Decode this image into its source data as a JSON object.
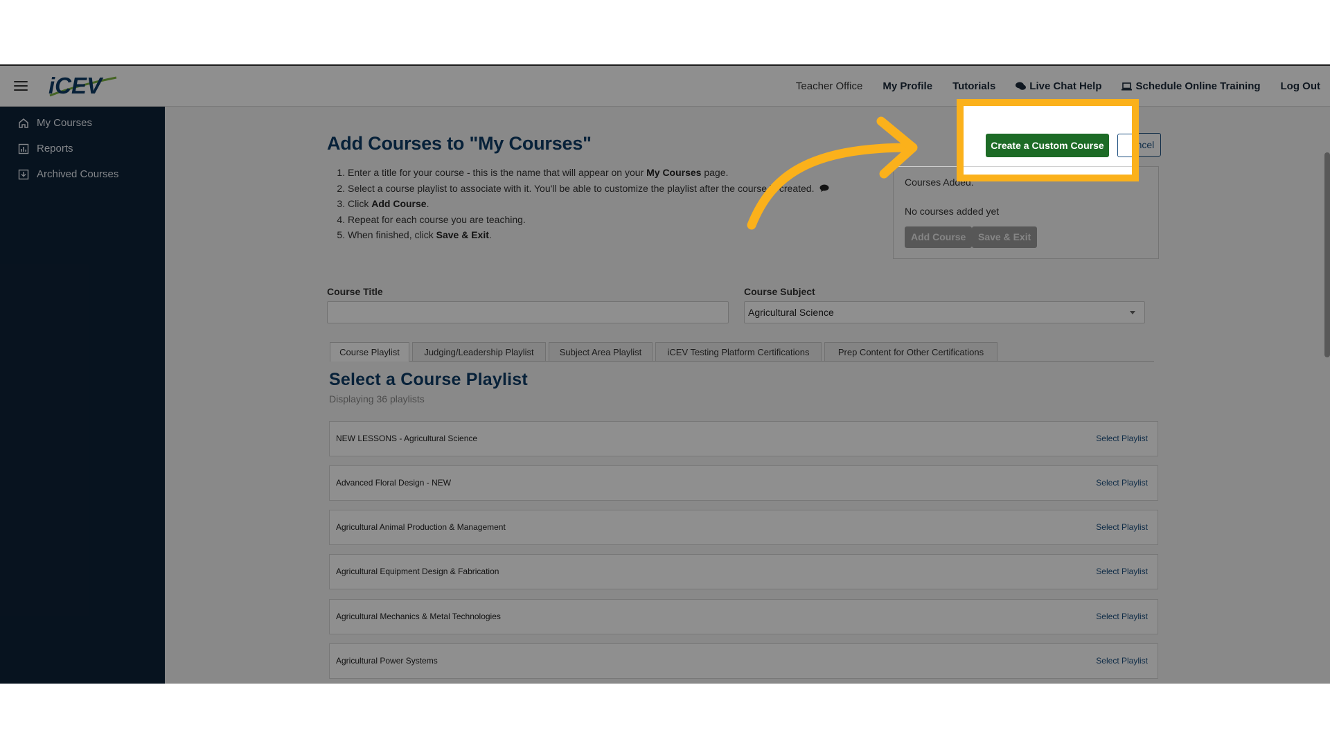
{
  "brand": {
    "logo_text": "iCEV"
  },
  "topnav": {
    "teacher_office": "Teacher Office",
    "my_profile": "My Profile",
    "tutorials": "Tutorials",
    "live_chat": "Live Chat Help",
    "schedule_training": "Schedule Online Training",
    "log_out": "Log Out"
  },
  "sidebar": {
    "items": [
      {
        "label": "My Courses",
        "icon": "home-icon"
      },
      {
        "label": "Reports",
        "icon": "chart-icon"
      },
      {
        "label": "Archived Courses",
        "icon": "archive-icon"
      }
    ]
  },
  "page": {
    "title": "Add Courses to \"My Courses\"",
    "steps": {
      "s1_pre": "Enter a title for your course - this is the name that will appear on your ",
      "s1_bold": "My Courses",
      "s1_post": " page.",
      "s2": "Select a course playlist to associate with it. You'll be able to customize the playlist after the course is created.",
      "s3_pre": "Click ",
      "s3_bold": "Add Course",
      "s3_post": ".",
      "s4": "Repeat for each course you are teaching.",
      "s5_pre": "When finished, click ",
      "s5_bold": "Save & Exit",
      "s5_post": "."
    }
  },
  "actions": {
    "create_custom": "Create a Custom Course",
    "cancel": "Cancel",
    "cancel_partial": "Ca",
    "courses_added_label": "Courses Added:",
    "no_courses": "No courses added yet",
    "add_course": "Add Course",
    "save_exit": "Save & Exit"
  },
  "form": {
    "course_title_label": "Course Title",
    "course_title_value": "",
    "course_subject_label": "Course Subject",
    "course_subject_value": "Agricultural Science"
  },
  "tabs": [
    "Course Playlist",
    "Judging/Leadership Playlist",
    "Subject Area Playlist",
    "iCEV Testing Platform Certifications",
    "Prep Content for Other Certifications"
  ],
  "playlists": {
    "title": "Select a Course Playlist",
    "count_text": "Displaying 36 playlists",
    "select_label": "Select Playlist",
    "items": [
      "NEW LESSONS - Agricultural Science",
      "Advanced Floral Design - NEW",
      "Agricultural Animal Production & Management",
      "Agricultural Equipment Design & Fabrication",
      "Agricultural Mechanics & Metal Technologies",
      "Agricultural Power Systems"
    ]
  },
  "colors": {
    "sidebar_bg": "#0e2238",
    "title_blue": "#0e3b66",
    "create_button_green": "#1d6b26",
    "highlight_orange": "#fbb11b"
  }
}
